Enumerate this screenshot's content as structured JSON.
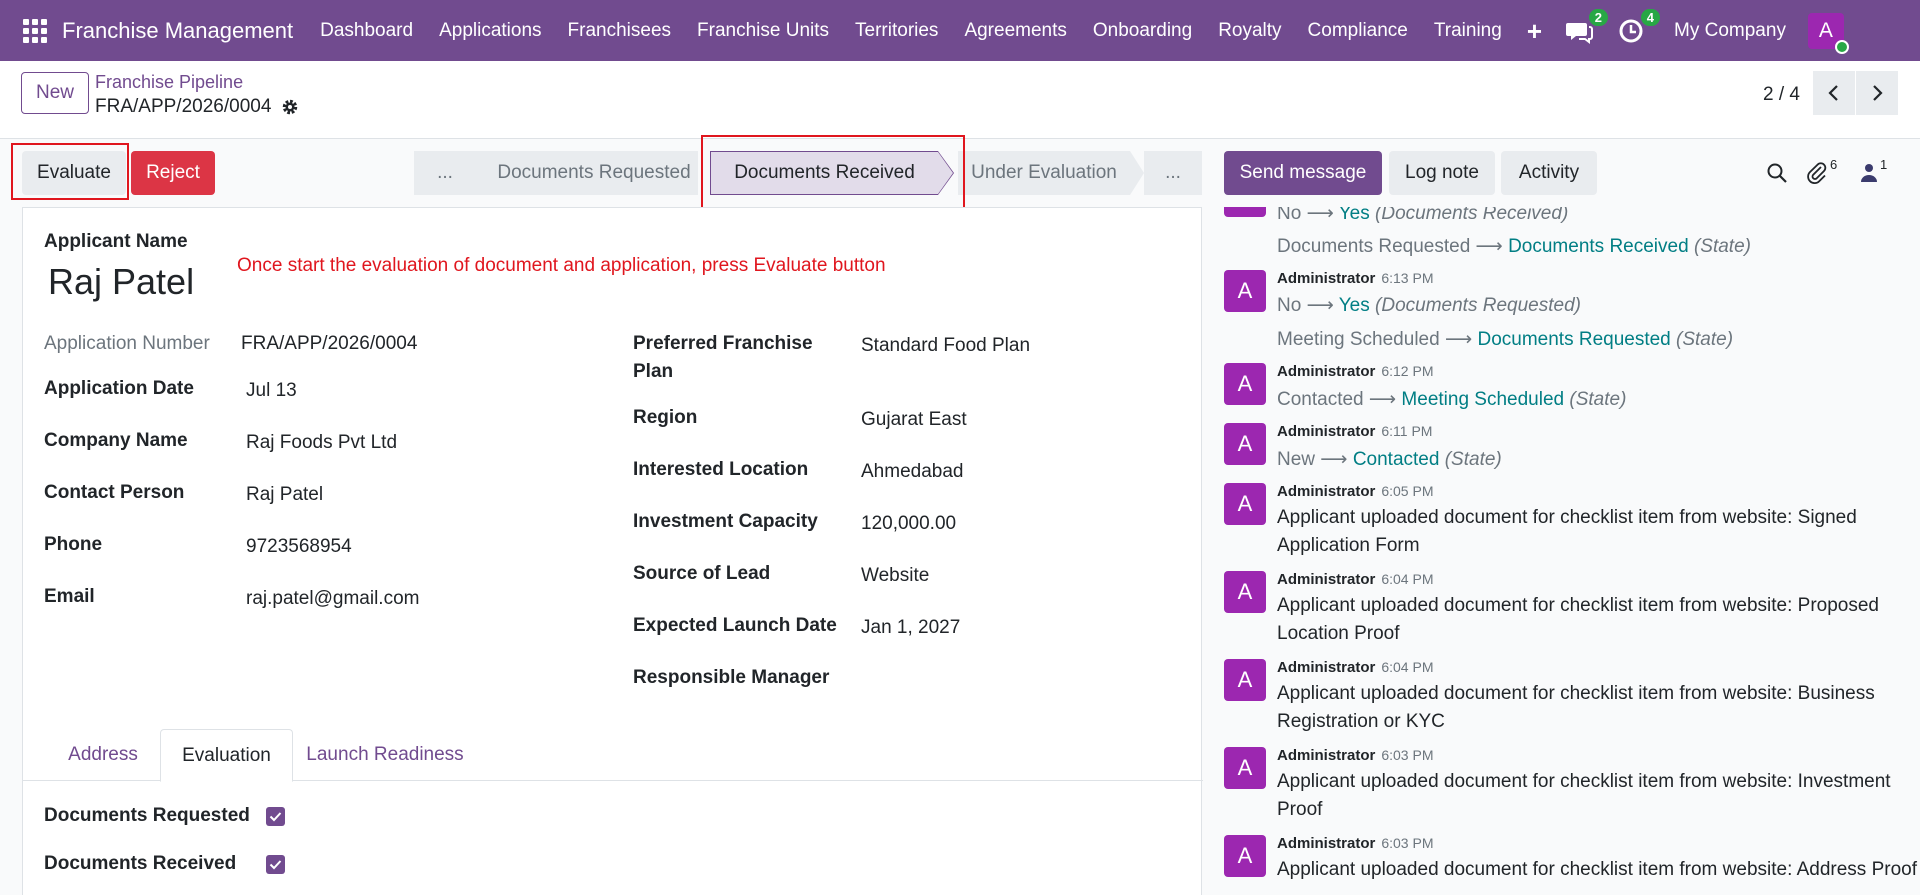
{
  "navbar": {
    "brand": "Franchise Management",
    "menu": [
      "Dashboard",
      "Applications",
      "Franchisees",
      "Franchise Units",
      "Territories",
      "Agreements",
      "Onboarding",
      "Royalty",
      "Compliance",
      "Training"
    ],
    "messages_badge": "2",
    "activities_badge": "4",
    "company": "My Company",
    "avatar_letter": "A"
  },
  "control": {
    "new_label": "New",
    "breadcrumb_parent": "Franchise Pipeline",
    "breadcrumb_current": "FRA/APP/2026/0004",
    "pager": "2 / 4"
  },
  "actions": {
    "evaluate": "Evaluate",
    "reject": "Reject"
  },
  "statusbar": {
    "more_left": "...",
    "stages": [
      "Documents Requested",
      "Documents Received",
      "Under Evaluation"
    ],
    "more_right": "..."
  },
  "chatter_buttons": {
    "send_message": "Send message",
    "log_note": "Log note",
    "activity": "Activity",
    "attachments_count": "6",
    "followers_count": "1"
  },
  "form": {
    "applicant_label": "Applicant Name",
    "applicant_name": "Raj Patel",
    "annotation": "Once start the evaluation of document and application, press Evaluate button",
    "left_fields": [
      {
        "label": "Application Number",
        "value": "FRA/APP/2026/0004"
      },
      {
        "label": "Application Date",
        "value": "Jul 13"
      },
      {
        "label": "Company Name",
        "value": "Raj Foods Pvt Ltd"
      },
      {
        "label": "Contact Person",
        "value": "Raj Patel"
      },
      {
        "label": "Phone",
        "value": "9723568954"
      },
      {
        "label": "Email",
        "value": "raj.patel@gmail.com"
      }
    ],
    "right_fields": [
      {
        "label": "Preferred Franchise Plan",
        "value": "Standard Food Plan"
      },
      {
        "label": "Region",
        "value": "Gujarat East"
      },
      {
        "label": "Interested Location",
        "value": "Ahmedabad"
      },
      {
        "label": "Investment Capacity",
        "value": "120,000.00"
      },
      {
        "label": "Source of Lead",
        "value": "Website"
      },
      {
        "label": "Expected Launch Date",
        "value": "Jan 1, 2027"
      },
      {
        "label": "Responsible Manager",
        "value": ""
      }
    ],
    "tabs": [
      "Address",
      "Evaluation",
      "Launch Readiness"
    ],
    "checks": [
      {
        "label": "Documents Requested",
        "checked": true
      },
      {
        "label": "Documents Received",
        "checked": true
      }
    ]
  },
  "chatter": {
    "top_track_1": {
      "old": "No",
      "new": "Yes",
      "field": "(Documents Received)"
    },
    "top_track_2": {
      "old": "Documents Requested",
      "new": "Documents Received",
      "field": "(State)"
    },
    "messages": [
      {
        "author": "Administrator",
        "time": "6:13 PM",
        "track1": {
          "old": "No",
          "new": "Yes",
          "field": "(Documents Requested)"
        },
        "track2": {
          "old": "Meeting Scheduled",
          "new": "Documents Requested",
          "field": "(State)"
        }
      },
      {
        "author": "Administrator",
        "time": "6:12 PM",
        "track1": {
          "old": "Contacted",
          "new": "Meeting Scheduled",
          "field": "(State)"
        }
      },
      {
        "author": "Administrator",
        "time": "6:11 PM",
        "track1": {
          "old": "New",
          "new": "Contacted",
          "field": "(State)"
        }
      },
      {
        "author": "Administrator",
        "time": "6:05 PM",
        "body": "Applicant uploaded document for checklist item from website: Signed Application Form"
      },
      {
        "author": "Administrator",
        "time": "6:04 PM",
        "body": "Applicant uploaded document for checklist item from website: Proposed Location Proof"
      },
      {
        "author": "Administrator",
        "time": "6:04 PM",
        "body": "Applicant uploaded document for checklist item from website: Business Registration or KYC"
      },
      {
        "author": "Administrator",
        "time": "6:03 PM",
        "body": "Applicant uploaded document for checklist item from website: Investment Proof"
      },
      {
        "author": "Administrator",
        "time": "6:03 PM",
        "body": "Applicant uploaded document for checklist item from website: Address Proof"
      }
    ]
  }
}
